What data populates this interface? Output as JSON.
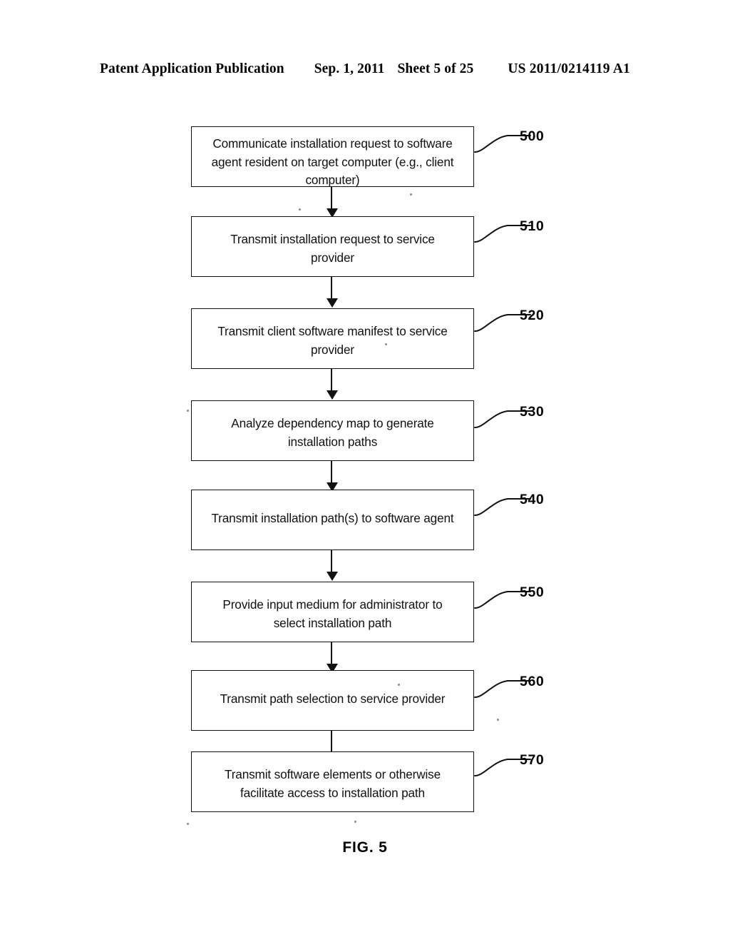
{
  "header": {
    "publication": "Patent Application Publication",
    "date": "Sep. 1, 2011",
    "sheet": "Sheet 5 of 25",
    "patent_number": "US 2011/0214119 A1"
  },
  "figure": {
    "caption": "FIG. 5",
    "type": "flowchart",
    "orientation": "vertical",
    "node_count": 8
  },
  "nodes": [
    {
      "ref": "500",
      "text": "Communicate installation request to software\nagent resident on target computer (e.g., client\ncomputer)",
      "lines": 3
    },
    {
      "ref": "510",
      "text": "Transmit installation request to service\nprovider",
      "lines": 2
    },
    {
      "ref": "520",
      "text": "Transmit client software manifest to service\nprovider",
      "lines": 2
    },
    {
      "ref": "530",
      "text": "Analyze dependency map to generate\ninstallation paths",
      "lines": 2
    },
    {
      "ref": "540",
      "text": "Transmit installation path(s) to software agent",
      "lines": 1
    },
    {
      "ref": "550",
      "text": "Provide input medium for administrator to\nselect installation path",
      "lines": 2
    },
    {
      "ref": "560",
      "text": "Transmit path selection to service provider",
      "lines": 1
    },
    {
      "ref": "570",
      "text": "Transmit software elements or otherwise\nfacilitate access to installation path",
      "lines": 2
    }
  ],
  "colors": {
    "ink": "#111111",
    "page": "#ffffff"
  }
}
